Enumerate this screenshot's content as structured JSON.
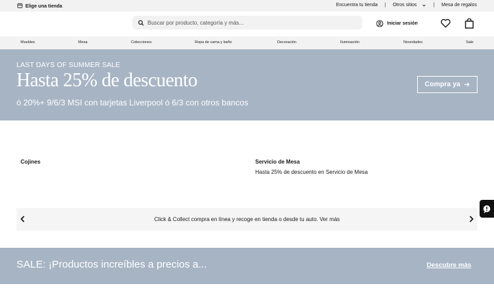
{
  "topbar": {
    "store_label": "Elige una tienda",
    "links": [
      "Encuentra tu tienda",
      "Otros sitios",
      "Mesa de regalos"
    ]
  },
  "header": {
    "search_placeholder": "Buscar por producto, categoría y más...",
    "login_label": "Iniciar sesión",
    "icons": [
      "calendar-store-icon",
      "search-icon",
      "user-icon",
      "heart-icon",
      "bag-icon"
    ]
  },
  "nav": {
    "items": [
      "Muebles",
      "Mesa",
      "Colecciones",
      "Ropa de cama y baño",
      "Decoración",
      "Iluminación",
      "Novedades",
      "Sale"
    ]
  },
  "promo": {
    "kicker": "LAST DAYS OF SUMMER SALE",
    "headline": "Hasta 25% de descuento",
    "subline": "ó 20%+ 9/6/3 MSI con tarjetas Liverpool ó 6/3 con otros bancos",
    "cta": "Compra ya"
  },
  "categories": [
    {
      "title": "Cojines",
      "desc": ""
    },
    {
      "title": "Servicio de Mesa",
      "desc": "Hasta 25% de descuento en Servicio de Mesa"
    }
  ],
  "carousel": {
    "message": "Click & Collect compra en línea y recoge en tienda o desde tu auto. Ver más"
  },
  "sale_banner": {
    "text": "SALE: ¡Productos increíbles a precios a...",
    "link": "Descubre más"
  },
  "colors": {
    "banner_bg": "#a7b4c4",
    "bar_bg": "#f2f2f2"
  }
}
